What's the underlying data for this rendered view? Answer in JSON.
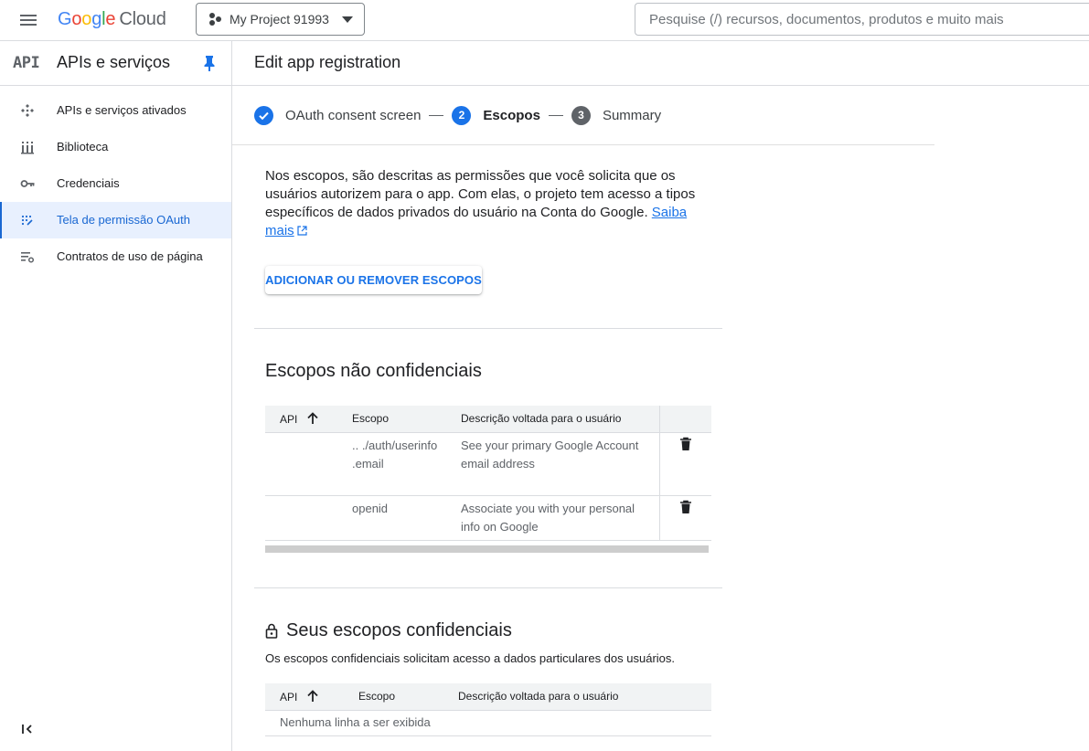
{
  "topbar": {
    "logo_google": [
      "G",
      "o",
      "o",
      "g",
      "l",
      "e"
    ],
    "logo_cloud": "Cloud",
    "project_name": "My Project 91993",
    "search_placeholder": "Pesquise (/) recursos, documentos, produtos e muito mais"
  },
  "sidebar": {
    "badge": "API",
    "title": "APIs e serviços",
    "items": [
      {
        "label": "APIs e serviços ativados",
        "icon": "api-hub-icon",
        "active": false
      },
      {
        "label": "Biblioteca",
        "icon": "library-icon",
        "active": false
      },
      {
        "label": "Credenciais",
        "icon": "key-icon",
        "active": false
      },
      {
        "label": "Tela de permissão OAuth",
        "icon": "oauth-icon",
        "active": true
      },
      {
        "label": "Contratos de uso de página",
        "icon": "settings-list-icon",
        "active": false
      }
    ]
  },
  "main": {
    "title": "Edit app registration",
    "steps": [
      {
        "number": "",
        "label": "OAuth consent screen",
        "state": "done"
      },
      {
        "number": "2",
        "label": "Escopos",
        "state": "current"
      },
      {
        "number": "3",
        "label": "Summary",
        "state": "todo"
      }
    ],
    "intro_text": "Nos escopos, são descritas as permissões que você solicita que os usuários autorizem para o app. Com elas, o projeto tem acesso a tipos específicos de dados privados do usuário na Conta do Google.",
    "learn_more": "Saiba mais",
    "add_remove_button": "ADICIONAR OU REMOVER ESCOPOS",
    "non_sensitive": {
      "title": "Escopos não confidenciais",
      "columns": [
        "API",
        "Escopo",
        "Descrição voltada para o usuário"
      ],
      "rows": [
        {
          "api": "",
          "scope": ".. ./auth/userinfo .email",
          "description": "See your primary Google Account email address"
        },
        {
          "api": "",
          "scope": "openid",
          "description": "Associate you with your personal info on Google"
        }
      ]
    },
    "sensitive": {
      "title": "Seus escopos confidenciais",
      "description": "Os escopos confidenciais solicitam acesso a dados particulares dos usuários.",
      "columns": [
        "API",
        "Escopo",
        "Descrição voltada para o usuário"
      ],
      "empty_message": "Nenhuma linha a ser exibida"
    }
  },
  "colors": {
    "accent": "#1a73e8",
    "active_nav_bg": "#e8f0fe",
    "table_header_bg": "#f1f3f4"
  }
}
